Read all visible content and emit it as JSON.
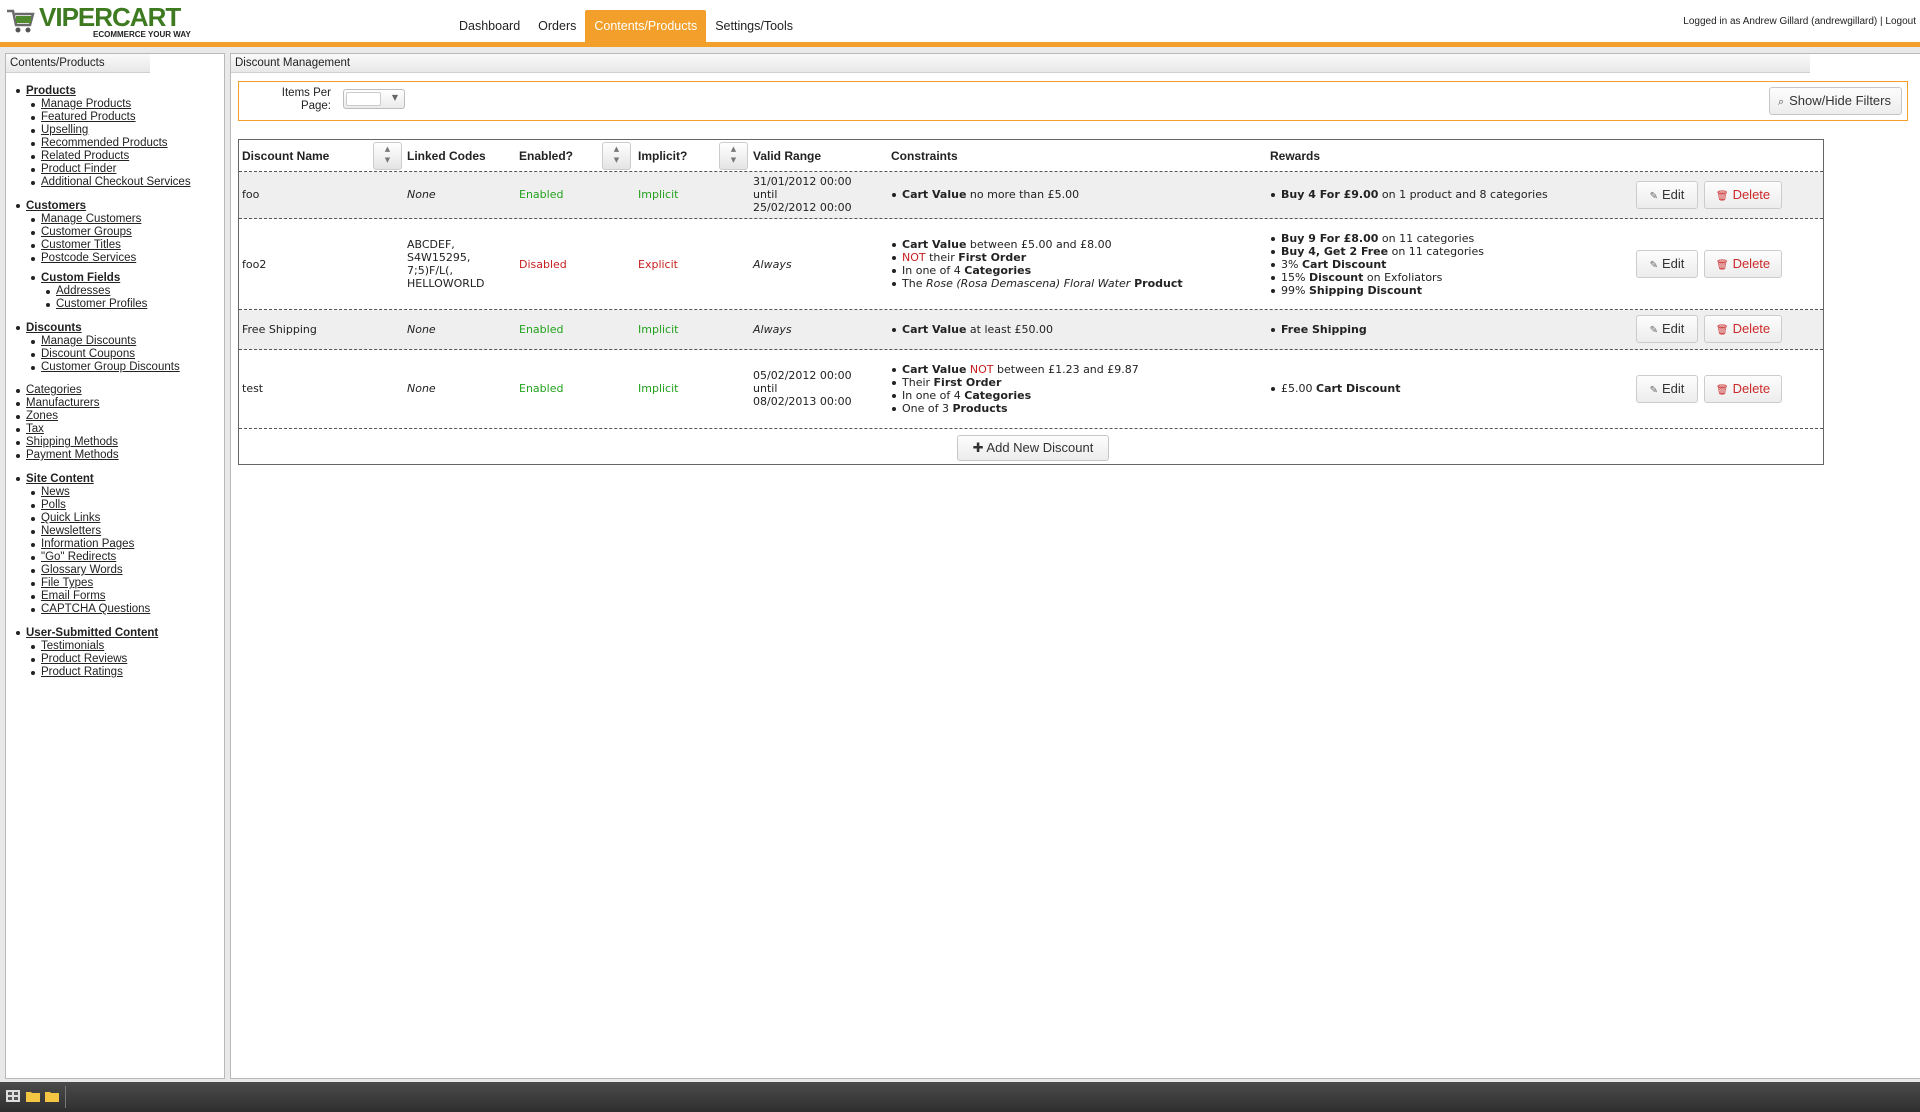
{
  "header": {
    "logo_word": "VIPERCART",
    "logo_tagline": "ECOMMERCE YOUR WAY",
    "nav": [
      {
        "label": "Dashboard"
      },
      {
        "label": "Orders"
      },
      {
        "label": "Contents/Products",
        "active": true
      },
      {
        "label": "Settings/Tools"
      }
    ],
    "login_text": "Logged in as Andrew Gillard (andrewgillard) | Logout",
    "accent_color": "#f2a02b"
  },
  "sidebar": {
    "title": "Contents/Products",
    "products": {
      "head": "Products",
      "items": [
        "Manage Products",
        "Featured Products",
        "Upselling",
        "Recommended Products",
        "Related Products",
        "Product Finder",
        "Additional Checkout Services"
      ]
    },
    "customers": {
      "head": "Customers",
      "items": [
        "Manage Customers",
        "Customer Groups",
        "Customer Titles",
        "Postcode Services"
      ],
      "custom_fields": {
        "head": "Custom Fields",
        "items": [
          "Addresses",
          "Customer Profiles"
        ]
      }
    },
    "discounts": {
      "head": "Discounts",
      "items": [
        "Manage Discounts",
        "Discount Coupons",
        "Customer Group Discounts"
      ]
    },
    "misc": [
      "Categories",
      "Manufacturers",
      "Zones",
      "Tax",
      "Shipping Methods",
      "Payment Methods"
    ],
    "site_content": {
      "head": "Site Content",
      "items": [
        "News",
        "Polls",
        "Quick Links",
        "Newsletters",
        "Information Pages",
        "\"Go\" Redirects",
        "Glossary Words",
        "File Types",
        "Email Forms",
        "CAPTCHA Questions"
      ]
    },
    "user_content": {
      "head": "User-Submitted Content",
      "items": [
        "Testimonials",
        "Product Reviews",
        "Product Ratings"
      ]
    }
  },
  "main": {
    "title": "Discount Management",
    "items_per_page_label": "Items Per Page:",
    "items_per_page_value": "",
    "show_hide_filters": "Show/Hide Filters",
    "columns": [
      "Discount Name",
      "Linked Codes",
      "Enabled?",
      "Implicit?",
      "Valid Range",
      "Constraints",
      "Rewards"
    ],
    "rows": [
      {
        "name": "foo",
        "codes": "None",
        "enabled": "Enabled",
        "implicit": "Implicit",
        "range": [
          "31/01/2012 00:00",
          "until",
          "25/02/2012 00:00"
        ]
      },
      {
        "name": "foo2",
        "codes": "ABCDEF, S4W15295, 7;5)F/L(, HELLOWORLD",
        "enabled": "Disabled",
        "implicit": "Explicit",
        "range": [
          "Always"
        ]
      },
      {
        "name": "Free Shipping",
        "codes": "None",
        "enabled": "Enabled",
        "implicit": "Implicit",
        "range": [
          "Always"
        ]
      },
      {
        "name": "test",
        "codes": "None",
        "enabled": "Enabled",
        "implicit": "Implicit",
        "range": [
          "05/02/2012 00:00",
          "until",
          "08/02/2013 00:00"
        ]
      }
    ],
    "constraints": {
      "r0": {
        "a": "Cart Value",
        "b": " no more than £5.00"
      },
      "r1": {
        "l1a": "Cart Value",
        "l1b": " between £5.00 and £8.00",
        "l2a": "NOT",
        "l2b": " their ",
        "l2c": "First Order",
        "l3a": "In one of 4 ",
        "l3b": "Categories",
        "l4a": "The ",
        "l4b": "Rose (Rosa Demascena) Floral Water",
        "l4c": " Product"
      },
      "r2": {
        "a": "Cart Value",
        "b": " at least £50.00"
      },
      "r3": {
        "l1a": "Cart Value",
        "l1b": " NOT",
        "l1c": " between £1.23 and £9.87",
        "l2a": "Their ",
        "l2b": "First Order",
        "l3a": "In one of 4 ",
        "l3b": "Categories",
        "l4a": "One of 3 ",
        "l4b": "Products"
      }
    },
    "rewards": {
      "r0": {
        "a": "Buy 4 For £9.00",
        "b": " on 1 product and 8 categories"
      },
      "r1": {
        "l1a": "Buy 9 For £8.00",
        "l1b": " on 11 categories",
        "l2a": "Buy 4, Get 2 Free",
        "l2b": " on 11 categories",
        "l3a": "3% ",
        "l3b": "Cart Discount",
        "l4a": "15% ",
        "l4b": "Discount",
        "l4c": " on Exfoliators",
        "l5a": "99% ",
        "l5b": "Shipping Discount"
      },
      "r2": {
        "a": "Free Shipping"
      },
      "r3": {
        "a": "£5.00 ",
        "b": "Cart Discount"
      }
    },
    "edit_label": "Edit",
    "delete_label": "Delete",
    "add_new_label": "Add New Discount",
    "status_colors": {
      "positive": "#22a21d",
      "negative": "#c71f1f"
    }
  }
}
